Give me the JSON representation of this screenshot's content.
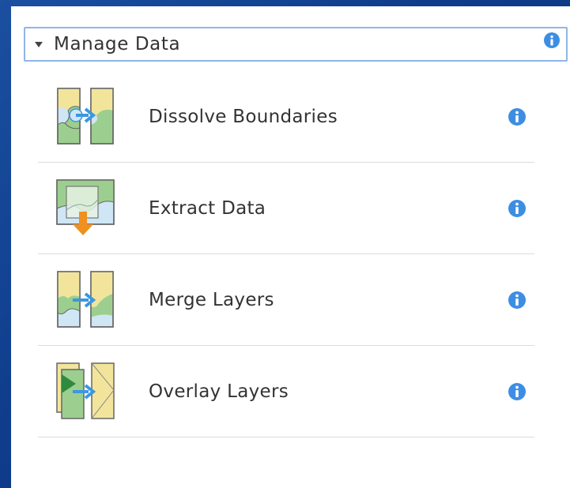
{
  "section": {
    "title": "Manage Data",
    "expanded": true
  },
  "tools": [
    {
      "label": "Dissolve Boundaries",
      "icon": "dissolve-boundaries-icon"
    },
    {
      "label": "Extract Data",
      "icon": "extract-data-icon"
    },
    {
      "label": "Merge Layers",
      "icon": "merge-layers-icon"
    },
    {
      "label": "Overlay Layers",
      "icon": "overlay-layers-icon"
    }
  ],
  "colors": {
    "background": "#1b4fa0",
    "header_border": "#8fb6e8",
    "info_icon": "#3d8ee3",
    "divider": "#dcdcdc",
    "map_yellow": "#f2e59b",
    "map_green": "#9ccf8f",
    "map_blue": "#cfe6f5",
    "arrow_blue": "#3b97e0",
    "arrow_orange": "#f0901e"
  }
}
